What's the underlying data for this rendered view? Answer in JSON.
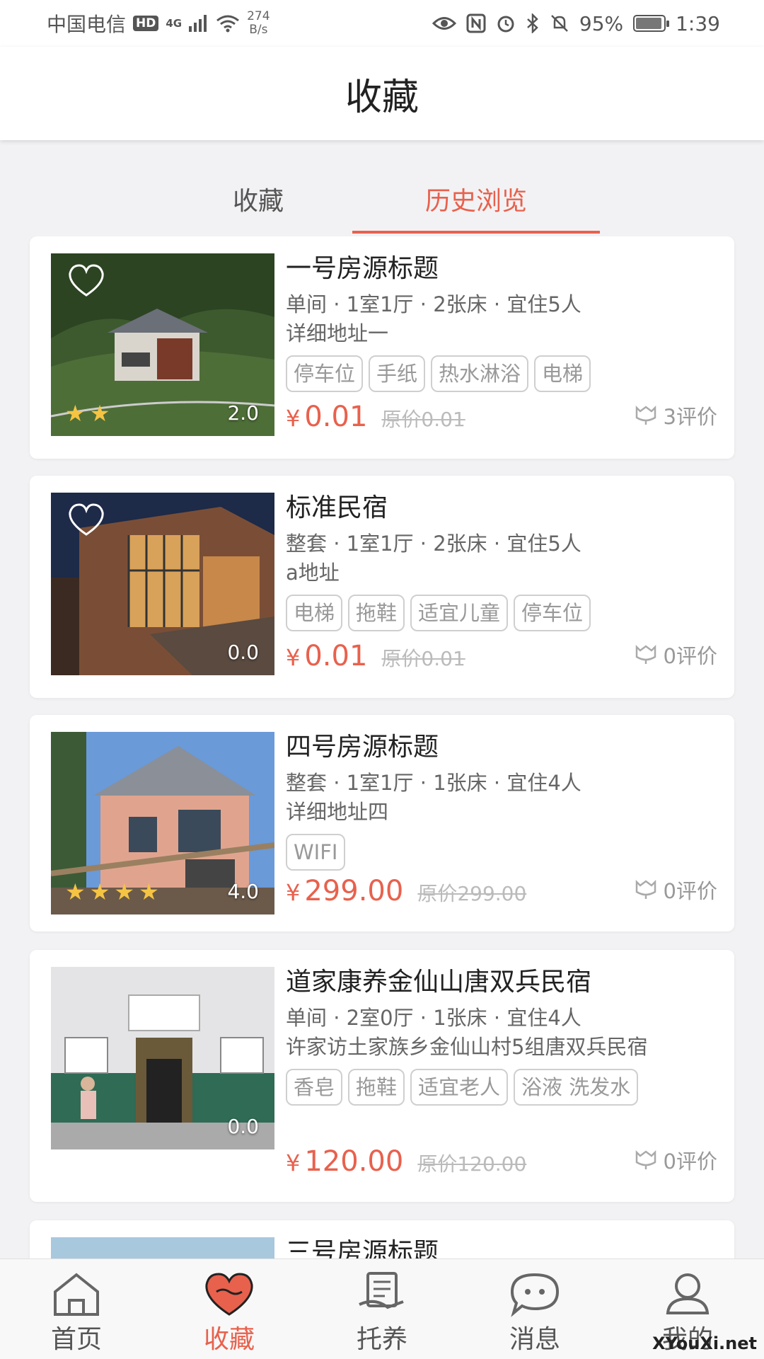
{
  "status": {
    "carrier": "中国电信",
    "hd": "HD",
    "signal": "4G",
    "speed_value": "274",
    "speed_unit": "B/s",
    "battery": "95%",
    "battery_level": 0.95,
    "time": "1:39"
  },
  "header": {
    "title": "收藏"
  },
  "tabs": [
    {
      "label": "收藏",
      "active": false
    },
    {
      "label": "历史浏览",
      "active": true
    }
  ],
  "listings": [
    {
      "title": "一号房源标题",
      "spec": "单间 · 1室1厅 · 2张床 · 宜住5人",
      "address": "详细地址一",
      "tags": [
        "停车位",
        "手纸",
        "热水淋浴",
        "电梯"
      ],
      "price_symbol": "¥",
      "price": "0.01",
      "original": "原价0.01",
      "reviews": "3评价",
      "rating": "2.0",
      "stars": 2
    },
    {
      "title": "标准民宿",
      "spec": "整套 · 1室1厅 · 2张床 · 宜住5人",
      "address": "a地址",
      "tags": [
        "电梯",
        "拖鞋",
        "适宜儿童",
        "停车位"
      ],
      "price_symbol": "¥",
      "price": "0.01",
      "original": "原价0.01",
      "reviews": "0评价",
      "rating": "0.0",
      "stars": 0
    },
    {
      "title": "四号房源标题",
      "spec": "整套 · 1室1厅 · 1张床 · 宜住4人",
      "address": "详细地址四",
      "tags": [
        "WIFI"
      ],
      "price_symbol": "¥",
      "price": "299.00",
      "original": "原价299.00",
      "reviews": "0评价",
      "rating": "4.0",
      "stars": 4
    },
    {
      "title": "道家康养金仙山唐双兵民宿",
      "spec": "单间 · 2室0厅 · 1张床 · 宜住4人",
      "address": "许家访土家族乡金仙山村5组唐双兵民宿",
      "tags": [
        "香皂",
        "拖鞋",
        "适宜老人",
        "浴液 洗发水"
      ],
      "price_symbol": "¥",
      "price": "120.00",
      "original": "原价120.00",
      "reviews": "0评价",
      "rating": "0.0",
      "stars": 0
    },
    {
      "title": "三号房源标题"
    }
  ],
  "nav": [
    {
      "label": "首页",
      "icon": "home-icon",
      "active": false
    },
    {
      "label": "收藏",
      "icon": "heart-icon",
      "active": true
    },
    {
      "label": "托养",
      "icon": "care-icon",
      "active": false
    },
    {
      "label": "消息",
      "icon": "message-icon",
      "active": false
    },
    {
      "label": "我的",
      "icon": "profile-icon",
      "active": false
    }
  ],
  "watermark": "XYouXi.net",
  "colors": {
    "accent": "#e8614d",
    "star": "#f5c443"
  }
}
